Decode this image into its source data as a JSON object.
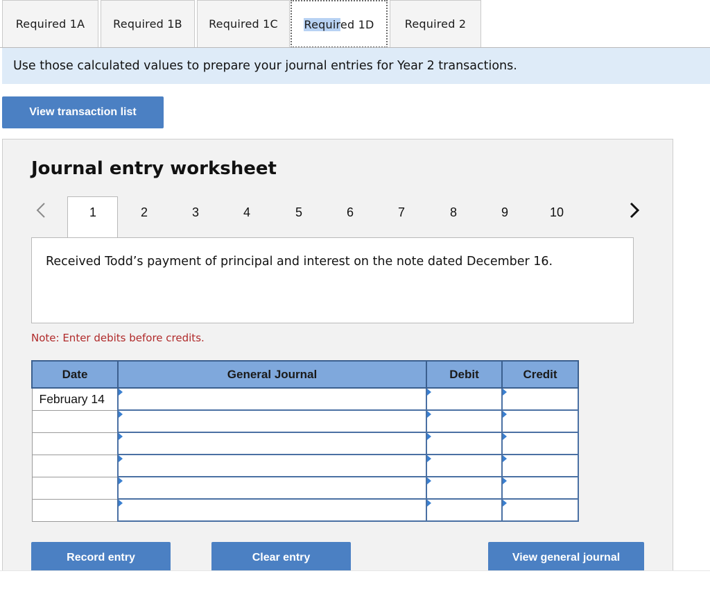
{
  "tabs": [
    {
      "label": "Required 1A",
      "active": false
    },
    {
      "label": "Required 1B",
      "active": false
    },
    {
      "label": "Required 1C",
      "active": false
    },
    {
      "label_highlight": "Requir",
      "label_rest": "ed 1D",
      "active": true
    },
    {
      "label": "Required 2",
      "active": false
    }
  ],
  "banner": "Use those calculated values to prepare your journal entries for Year 2 transactions.",
  "view_transaction_list": "View transaction list",
  "worksheet": {
    "title": "Journal entry worksheet",
    "prev_icon": "chevron-left-icon",
    "next_icon": "chevron-right-icon",
    "pages": [
      "1",
      "2",
      "3",
      "4",
      "5",
      "6",
      "7",
      "8",
      "9",
      "10"
    ],
    "active_page": "1",
    "description": "Received Todd’s payment of principal and interest on the note dated December 16.",
    "note": "Note: Enter debits before credits."
  },
  "journal": {
    "headers": {
      "date": "Date",
      "general_journal": "General Journal",
      "debit": "Debit",
      "credit": "Credit"
    },
    "rows": [
      {
        "date": "February 14",
        "account": "",
        "debit": "",
        "credit": ""
      },
      {
        "date": "",
        "account": "",
        "debit": "",
        "credit": ""
      },
      {
        "date": "",
        "account": "",
        "debit": "",
        "credit": ""
      },
      {
        "date": "",
        "account": "",
        "debit": "",
        "credit": ""
      },
      {
        "date": "",
        "account": "",
        "debit": "",
        "credit": ""
      },
      {
        "date": "",
        "account": "",
        "debit": "",
        "credit": ""
      }
    ]
  },
  "buttons": {
    "record_entry": "Record entry",
    "clear_entry": "Clear entry",
    "view_general_journal": "View general journal"
  },
  "colors": {
    "button": "#4b80c3",
    "header": "#7fa8dc",
    "banner": "#deebf8",
    "note": "#b02a2a"
  }
}
